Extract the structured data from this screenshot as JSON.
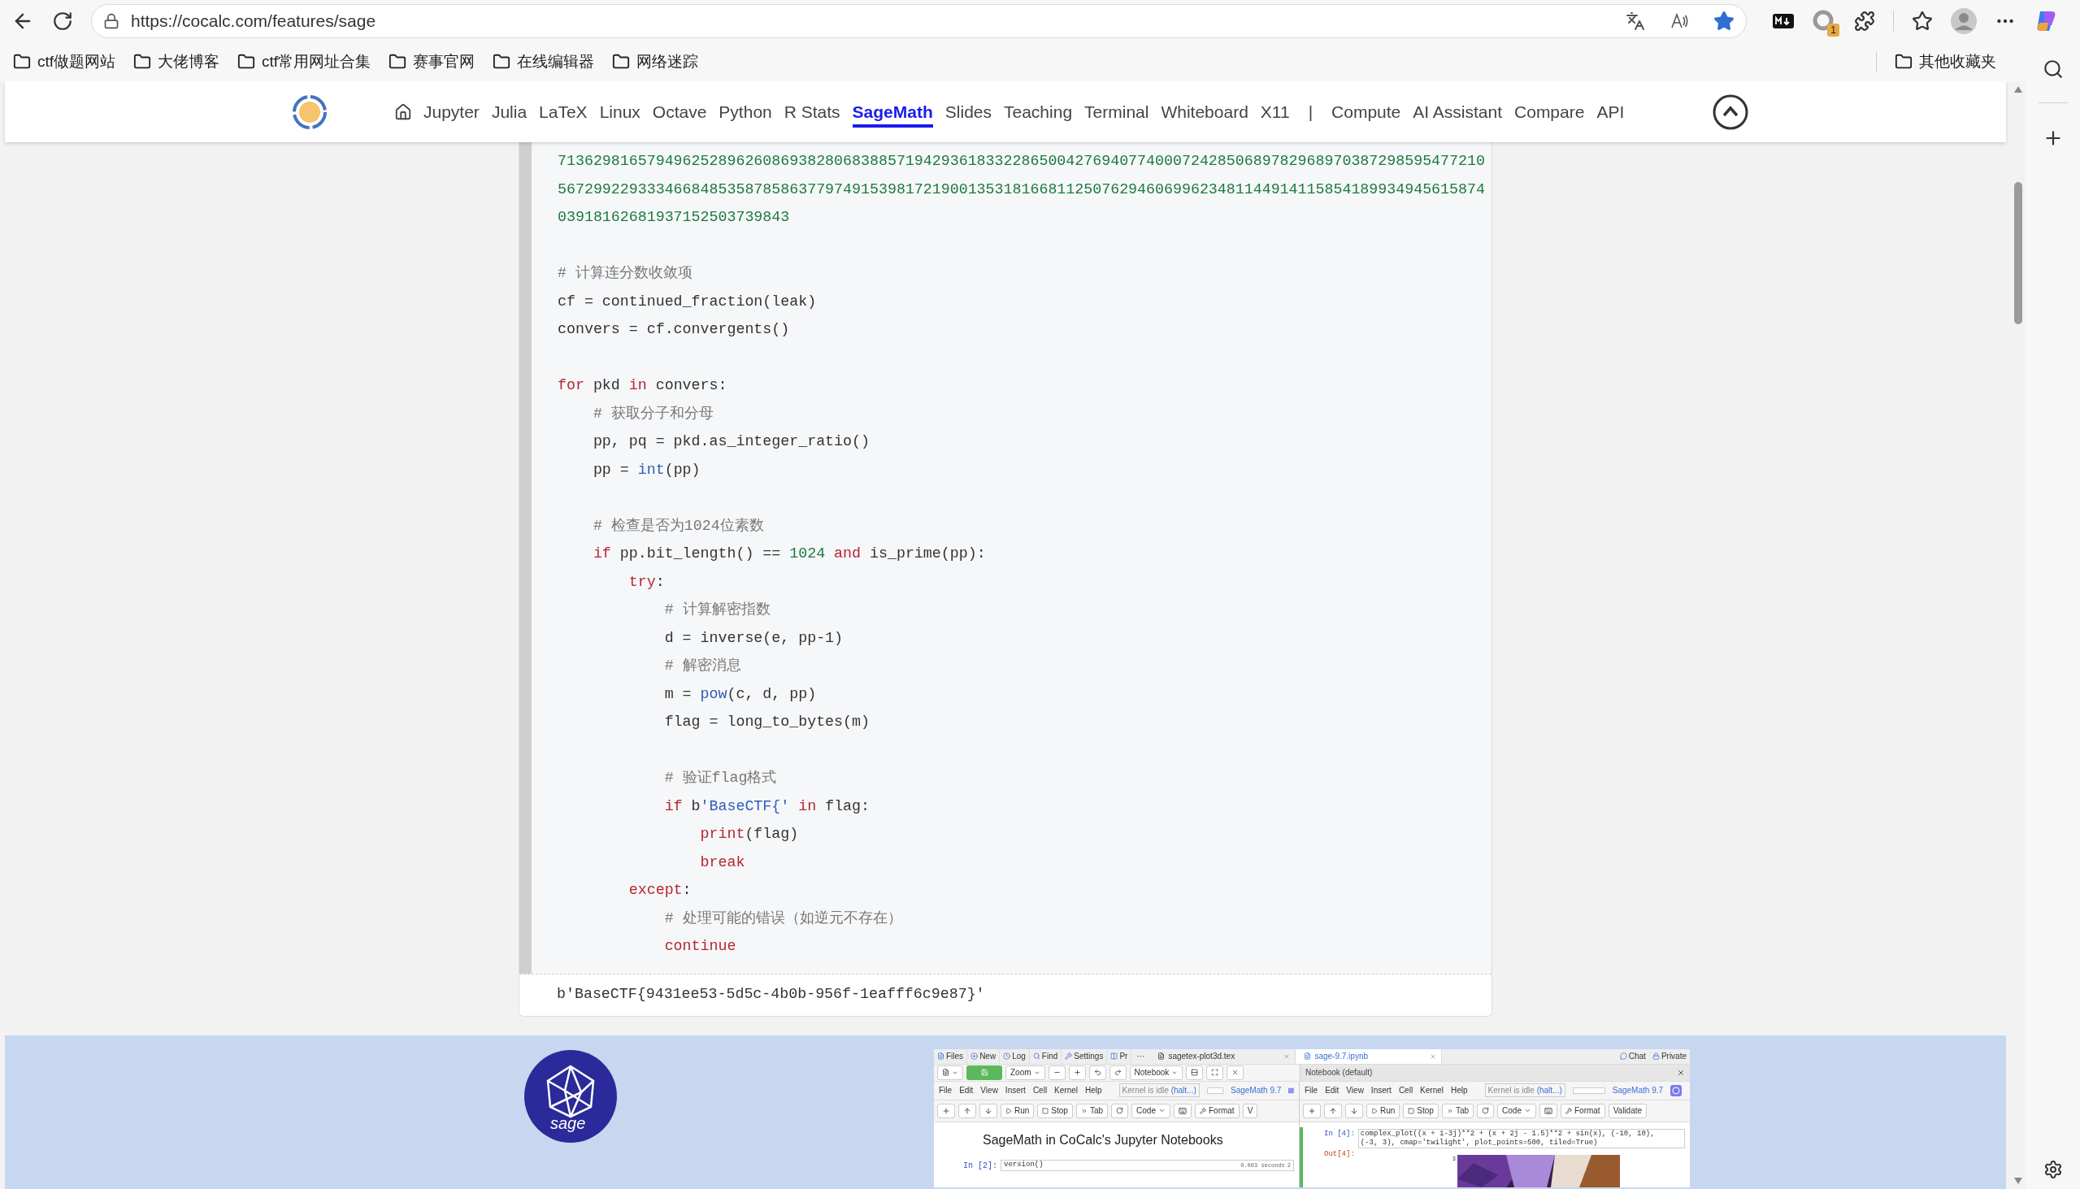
{
  "browser": {
    "url": "https://cocalc.com/features/sage",
    "extension_badge": "1",
    "bookmarks": [
      "ctf做题网站",
      "大佬博客",
      "ctf常用网址合集",
      "赛事官网",
      "在线编辑器",
      "网络迷踪"
    ],
    "other_bookmarks": "其他收藏夹"
  },
  "nav": {
    "links": [
      {
        "label": "Jupyter",
        "selected": false
      },
      {
        "label": "Julia",
        "selected": false
      },
      {
        "label": "LaTeX",
        "selected": false
      },
      {
        "label": "Linux",
        "selected": false
      },
      {
        "label": "Octave",
        "selected": false
      },
      {
        "label": "Python",
        "selected": false
      },
      {
        "label": "R Stats",
        "selected": false
      },
      {
        "label": "SageMath",
        "selected": true
      },
      {
        "label": "Slides",
        "selected": false
      },
      {
        "label": "Teaching",
        "selected": false
      },
      {
        "label": "Terminal",
        "selected": false
      },
      {
        "label": "Whiteboard",
        "selected": false
      },
      {
        "label": "X11",
        "selected": false
      }
    ],
    "separator": "|",
    "secondary_links": [
      "Compute",
      "AI Assistant",
      "Compare",
      "API"
    ]
  },
  "code_cell": {
    "lines": [
      {
        "kind": "code",
        "tokens": [
          {
            "kind": "num",
            "text": "71362981657949625289626086938280683885719429361833228650042769407740007242850689782968970387298595477210"
          }
        ]
      },
      {
        "kind": "code",
        "tokens": [
          {
            "kind": "num",
            "text": "56729922933346684853587858637797491539817219001353181668112507629460699623481144914115854189934945615874"
          }
        ]
      },
      {
        "kind": "code",
        "tokens": [
          {
            "kind": "num",
            "text": "03918162681937152503739843"
          }
        ]
      },
      {
        "kind": "blank"
      },
      {
        "kind": "code",
        "tokens": [
          {
            "kind": "comment",
            "text": "# 计算连分数收敛项"
          }
        ]
      },
      {
        "kind": "code",
        "tokens": [
          {
            "kind": "plain",
            "text": "cf = continued_fraction(leak)"
          }
        ]
      },
      {
        "kind": "code",
        "tokens": [
          {
            "kind": "plain",
            "text": "convers = cf.convergents()"
          }
        ]
      },
      {
        "kind": "blank"
      },
      {
        "kind": "code",
        "tokens": [
          {
            "kind": "kw",
            "text": "for"
          },
          {
            "kind": "plain",
            "text": " pkd "
          },
          {
            "kind": "kw",
            "text": "in"
          },
          {
            "kind": "plain",
            "text": " convers:"
          }
        ]
      },
      {
        "kind": "code",
        "tokens": [
          {
            "kind": "comment",
            "text": "    # 获取分子和分母"
          }
        ]
      },
      {
        "kind": "code",
        "tokens": [
          {
            "kind": "plain",
            "text": "    pp, pq = pkd.as_integer_ratio()"
          }
        ]
      },
      {
        "kind": "code",
        "tokens": [
          {
            "kind": "plain",
            "text": "    pp = "
          },
          {
            "kind": "builtin",
            "text": "int"
          },
          {
            "kind": "plain",
            "text": "(pp)"
          }
        ]
      },
      {
        "kind": "blank"
      },
      {
        "kind": "code",
        "tokens": [
          {
            "kind": "comment",
            "text": "    # 检查是否为1024位素数"
          }
        ]
      },
      {
        "kind": "code",
        "tokens": [
          {
            "kind": "kw",
            "text": "    if"
          },
          {
            "kind": "plain",
            "text": " pp.bit_length() == "
          },
          {
            "kind": "num",
            "text": "1024"
          },
          {
            "kind": "kw",
            "text": " and"
          },
          {
            "kind": "plain",
            "text": " is_prime(pp):"
          }
        ]
      },
      {
        "kind": "code",
        "tokens": [
          {
            "kind": "kw",
            "text": "        try"
          },
          {
            "kind": "plain",
            "text": ":"
          }
        ]
      },
      {
        "kind": "code",
        "tokens": [
          {
            "kind": "comment",
            "text": "            # 计算解密指数"
          }
        ]
      },
      {
        "kind": "code",
        "tokens": [
          {
            "kind": "plain",
            "text": "            d = inverse(e, pp-1)"
          }
        ]
      },
      {
        "kind": "code",
        "tokens": [
          {
            "kind": "comment",
            "text": "            # 解密消息"
          }
        ]
      },
      {
        "kind": "code",
        "tokens": [
          {
            "kind": "plain",
            "text": "            m = "
          },
          {
            "kind": "builtin",
            "text": "pow"
          },
          {
            "kind": "plain",
            "text": "(c, d, pp)"
          }
        ]
      },
      {
        "kind": "code",
        "tokens": [
          {
            "kind": "plain",
            "text": "            flag = long_to_bytes(m)"
          }
        ]
      },
      {
        "kind": "blank"
      },
      {
        "kind": "code",
        "tokens": [
          {
            "kind": "comment",
            "text": "            # 验证flag格式"
          }
        ]
      },
      {
        "kind": "code",
        "tokens": [
          {
            "kind": "kw",
            "text": "            if"
          },
          {
            "kind": "plain",
            "text": " b"
          },
          {
            "kind": "str",
            "text": "'BaseCTF{'"
          },
          {
            "kind": "kw",
            "text": " in"
          },
          {
            "kind": "plain",
            "text": " flag:"
          }
        ]
      },
      {
        "kind": "code",
        "tokens": [
          {
            "kind": "kw",
            "text": "                print"
          },
          {
            "kind": "plain",
            "text": "(flag)"
          }
        ]
      },
      {
        "kind": "code",
        "tokens": [
          {
            "kind": "kw",
            "text": "                break"
          }
        ]
      },
      {
        "kind": "code",
        "tokens": [
          {
            "kind": "kw",
            "text": "        except"
          },
          {
            "kind": "plain",
            "text": ":"
          }
        ]
      },
      {
        "kind": "code",
        "tokens": [
          {
            "kind": "comment",
            "text": "            # 处理可能的错误（如逆元不存在）"
          }
        ]
      },
      {
        "kind": "code",
        "tokens": [
          {
            "kind": "kw",
            "text": "            continue"
          }
        ]
      }
    ],
    "output": "b'BaseCTF{9431ee53-5d5c-4b0b-956f-1eafff6c9e87}'"
  },
  "sage_section": {
    "logo_text": "sage",
    "app_screenshot": {
      "top_tabs": [
        "Files",
        "New",
        "Log",
        "Find",
        "Settings",
        "Pr"
      ],
      "more": "···",
      "file_tabs": [
        {
          "label": "sagetex-plot3d.tex",
          "selected": false
        },
        {
          "label": "sage-9.7.ipynb",
          "selected": true
        }
      ],
      "right_links": [
        "Chat",
        "Private"
      ],
      "zoom": "Zoom",
      "notebook": "Notebook",
      "pane_title": "Notebook (default)",
      "panes": [
        {
          "menus": [
            "File",
            "Edit",
            "View",
            "Insert",
            "Cell",
            "Kernel",
            "Help"
          ],
          "kernel_status": "Kernel is idle",
          "kernel_link": "(halt...)",
          "kernel_name": "SageMath 9.7",
          "buttons": [
            "Run",
            "Stop",
            "Tab",
            "Code",
            "Format",
            "V"
          ]
        },
        {
          "menus": [
            "File",
            "Edit",
            "View",
            "Insert",
            "Cell",
            "Kernel",
            "Help"
          ],
          "kernel_status": "Kernel is idle",
          "kernel_link": "(halt...)",
          "kernel_name": "SageMath 9.7",
          "buttons": [
            "Run",
            "Stop",
            "Tab",
            "Code",
            "Format",
            "Validate"
          ]
        }
      ],
      "left_cell": {
        "heading": "SageMath in CoCalc's Jupyter Notebooks",
        "prompt": "In [2]:",
        "input": "version()",
        "timing": "0.003 seconds",
        "count": "2"
      },
      "right_cell": {
        "prompt": "In [4]:",
        "input_lines": [
          "complex_plot((x + 1-3j)**2 + (x + 2j - 1.5)**2 + sin(x), (-10, 10),",
          "(-3, 3), cmap='twilight', plot_points=500, tiled=True)"
        ],
        "output_prompt": "Out[4]:",
        "axis_tick": "3"
      }
    }
  }
}
